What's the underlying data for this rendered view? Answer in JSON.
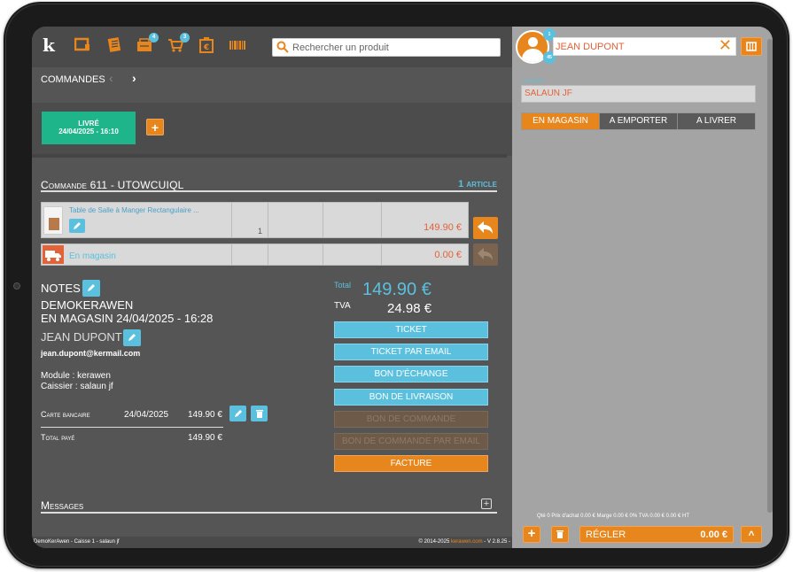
{
  "colors": {
    "accent": "#e8861e",
    "info": "#5bc0de",
    "success": "#1fb58a",
    "danger": "#e0633a"
  },
  "toolbar": {
    "logo": "k",
    "icons": [
      {
        "name": "register-icon",
        "badge": ""
      },
      {
        "name": "orders-icon",
        "badge": ""
      },
      {
        "name": "cash-drawer-icon",
        "badge": "4"
      },
      {
        "name": "cart-icon",
        "badge": "3"
      },
      {
        "name": "receipt-icon",
        "badge": ""
      },
      {
        "name": "barcode-icon",
        "badge": ""
      }
    ],
    "search_placeholder": "Rechercher un produit"
  },
  "orders_nav": {
    "label": "COMMANDES",
    "prev": "‹",
    "next": "›"
  },
  "status": {
    "label": "LIVRÉ",
    "date": "24/04/2025 - 16:10",
    "add": "+"
  },
  "order": {
    "title": "Commande 611 - UTOWCUIQL",
    "articles": "1 article",
    "line": {
      "name": "Table de Salle à  Manger Rectangulaire ...",
      "qty": "1",
      "price": "149.90 €"
    },
    "shipping": {
      "name": "En magasin",
      "price": "0.00 €"
    }
  },
  "notes": {
    "label": "NOTES",
    "shop": "DEMOKERAWEN",
    "mode": "EN MAGASIN 24/04/2025 - 16:28",
    "customer": "JEAN DUPONT",
    "email": "jean.dupont@kermail.com",
    "module": "Module : kerawen",
    "cashier": "Caissier : salaun jf"
  },
  "payment": {
    "method": "Carte bancaire",
    "date": "24/04/2025",
    "amount": "149.90 €",
    "total_label": "Total payé",
    "total_value": "149.90 €"
  },
  "totals": {
    "total_label": "Total",
    "total_value": "149.90 €",
    "tva_label": "TVA",
    "tva_value": "24.98 €"
  },
  "actions": [
    {
      "label": "TICKET",
      "style": "blue"
    },
    {
      "label": "TICKET PAR EMAIL",
      "style": "blue"
    },
    {
      "label": "BON D'ÉCHANGE",
      "style": "blue"
    },
    {
      "label": "BON DE LIVRAISON",
      "style": "blue"
    },
    {
      "label": "BON DE COMMANDE",
      "style": "dim"
    },
    {
      "label": "BON DE COMMANDE PAR EMAIL",
      "style": "dim"
    },
    {
      "label": "FACTURE",
      "style": "orange"
    }
  ],
  "messages": {
    "label": "Messages",
    "expand": "+"
  },
  "footer": {
    "left": "DemoKerAwen - Caisse 1 - salaun jf",
    "copyright": "© 2014-2025 ",
    "brand": "kerawen.com",
    "version": " - V 2.8.25 -"
  },
  "cart": {
    "avatar_badge_top": "1",
    "avatar_badge_bottom": "45",
    "customer_name": "JEAN DUPONT",
    "clear": "✕",
    "cashier_label": "CAISSIER",
    "cashier_name": "SALAUN JF",
    "tabs": [
      {
        "label": "EN MAGASIN",
        "active": true
      },
      {
        "label": "A EMPORTER",
        "active": false
      },
      {
        "label": "A LIVRER",
        "active": false
      }
    ],
    "summary": "Qté 0   Prix d'achat 0.00 €   Marge 0.00 € 0%   TVA 0.00 €   0.00 € HT",
    "add": "+",
    "pay_label": "RÉGLER",
    "pay_value": "0.00 €",
    "up": "^"
  }
}
